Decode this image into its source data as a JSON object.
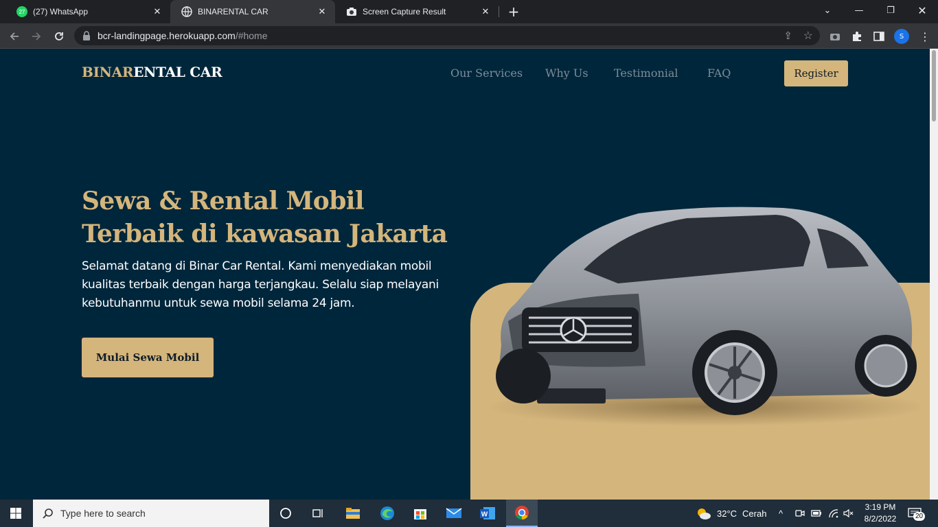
{
  "browser": {
    "tabs": [
      {
        "title": "(27) WhatsApp",
        "badge": "27",
        "icon": "whatsapp-icon"
      },
      {
        "title": "BINARENTAL CAR",
        "icon": "globe-icon"
      },
      {
        "title": "Screen Capture Result",
        "icon": "camera-icon"
      }
    ],
    "url_host": "bcr-landingpage.herokuapp.com",
    "url_path": "/#home",
    "profile_initial": "S"
  },
  "site": {
    "brand_part1": "BINAR",
    "brand_part2": "ENTAL CAR",
    "nav": [
      "Our Services",
      "Why Us",
      "Testimonial",
      "FAQ"
    ],
    "register_label": "Register",
    "hero_title_line1": "Sewa & Rental Mobil",
    "hero_title_line2": "Terbaik di kawasan Jakarta",
    "hero_description": "Selamat datang di Binar Car Rental. Kami menyediakan mobil kualitas terbaik dengan harga terjangkau. Selalu siap melayani kebutuhanmu untuk sewa mobil selama 24 jam.",
    "cta_label": "Mulai Sewa Mobil",
    "colors": {
      "background": "#00263b",
      "accent": "#d4b57c",
      "nav_text": "#7c8d99"
    }
  },
  "taskbar": {
    "search_placeholder": "Type here to search",
    "weather_temp": "32°C",
    "weather_text": "Cerah",
    "time": "3:19 PM",
    "date": "8/2/2022",
    "notification_count": "20"
  }
}
